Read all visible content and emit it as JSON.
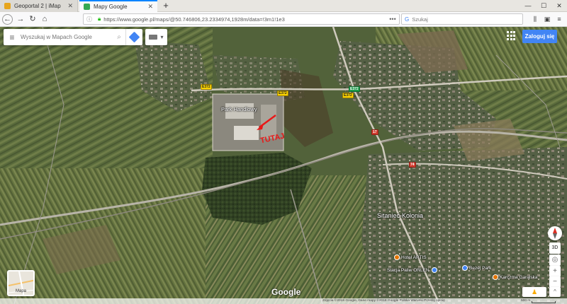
{
  "browser": {
    "tabs": [
      {
        "title": "Geoportal 2 | iMap",
        "favicon_color": "#e7a51c"
      },
      {
        "title": "Mapy Google",
        "favicon_color": "#34a853"
      }
    ],
    "new_tab_label": "+",
    "url": "https://www.google.pl/maps/@50.746806,23.2334974,1928m/data=!3m1!1e3",
    "page_actions_label": "•••",
    "search_placeholder": "Szukaj",
    "window_controls": [
      "—",
      "☐",
      "✕"
    ]
  },
  "maps": {
    "search_placeholder": "Wyszukaj w Mapach Google",
    "login_label": "Zaloguj się",
    "annotation": "TUTAJ",
    "labels": [
      {
        "name": "place-label-park",
        "text": "Park Handlowy"
      },
      {
        "name": "place-label-sitaniec",
        "text": "Sitaniec-Kolonia"
      },
      {
        "name": "place-label-artis",
        "text": "Hotel ARTIS"
      },
      {
        "name": "place-label-orlen",
        "text": "Stacja Paliw ORLEN"
      },
      {
        "name": "place-label-karczma",
        "text": "Karczma Garalska"
      },
      {
        "name": "place-label-bezej",
        "text": "Bezej Park"
      }
    ],
    "road_badges": [
      "E372",
      "E372",
      "E372",
      "E372",
      "17",
      "74"
    ],
    "thumbnail_label": "Mapa",
    "controls": {
      "tilt": "3D",
      "zoom_in": "+",
      "zoom_out": "−",
      "expand": "^"
    },
    "brand": "Google",
    "footer_text": "Zdjęcia ©2018 Google, Dane mapy ©2018 Google   Polska   Warunki   Prześlij opinię",
    "scale": "500 m",
    "colors": {
      "accent": "#4285f4",
      "annotation": "#e81919",
      "tab_indicator": "#0a84ff"
    }
  }
}
